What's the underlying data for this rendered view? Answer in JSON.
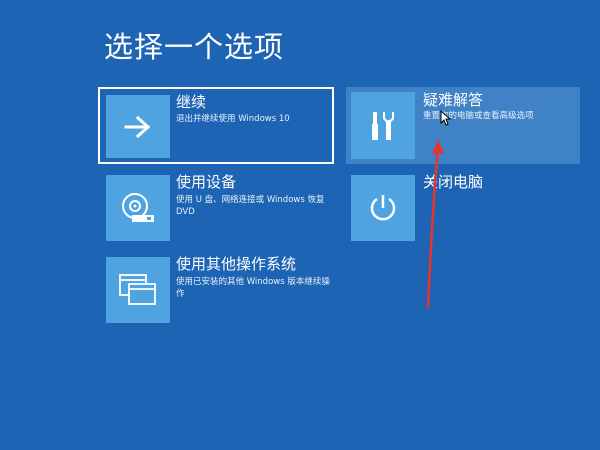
{
  "page_title": "选择一个选项",
  "options": {
    "continue": {
      "label": "继续",
      "description": "退出并继续使用 Windows 10",
      "icon": "arrow-right-icon"
    },
    "troubleshoot": {
      "label": "疑难解答",
      "description": "重置你的电脑或查看高级选项",
      "icon": "tools-icon"
    },
    "use_device": {
      "label": "使用设备",
      "description": "使用 U 盘、网络连接或 Windows 恢复 DVD",
      "icon": "disc-drive-icon"
    },
    "shutdown": {
      "label": "关闭电脑",
      "icon": "power-icon"
    },
    "other_os": {
      "label": "使用其他操作系统",
      "description": "使用已安装的其他 Windows 版本继续操作",
      "icon": "windows-stack-icon"
    }
  },
  "colors": {
    "background": "#1e64b4",
    "tile": "#4fa3e0",
    "hover": "#3f82c6",
    "annotation": "#e8332e"
  }
}
